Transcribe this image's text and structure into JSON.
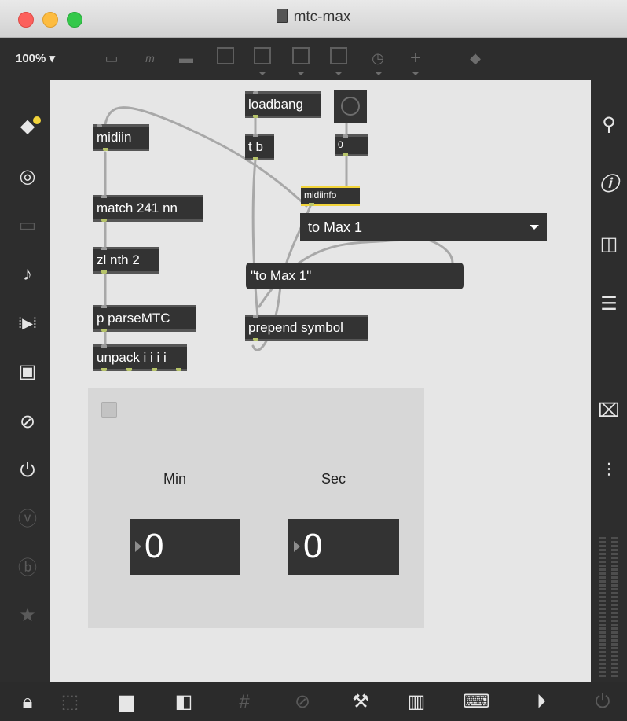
{
  "window": {
    "title": "mtc-max"
  },
  "toolbar": {
    "zoom": "100% ▾"
  },
  "objects": {
    "midiin": "midiin",
    "match": "match 241 nn",
    "zlnth": "zl nth 2",
    "parse": "p parseMTC",
    "unpack": "unpack i i i i",
    "loadbang": "loadbang",
    "tb": "t b",
    "zero": "0",
    "midiinfo": "midiinfo",
    "prepend": "prepend symbol"
  },
  "menu": {
    "selected": "to Max 1"
  },
  "message": {
    "text": "\"to Max 1\""
  },
  "panel": {
    "min_label": "Min",
    "sec_label": "Sec",
    "min_value": "0",
    "sec_value": "0"
  },
  "colors": {
    "canvas": "#e6e6e6",
    "object_bg": "#333333",
    "midiinfo_highlight": "#f2d43a",
    "panel_bg": "#d7d7d7"
  },
  "icons": {
    "left_sidebar": [
      "new-object-icon",
      "target-icon",
      "window-icon",
      "music-note-icon",
      "playback-icon",
      "image-icon",
      "paperclip-icon",
      "plug-icon",
      "v-circle-icon",
      "b-circle-icon",
      "star-icon"
    ],
    "right_sidebar": [
      "search-icon",
      "info-icon",
      "columns-icon",
      "list-icon",
      "camera-icon",
      "mixer-icon"
    ],
    "bottom_bar": [
      "lock-icon",
      "select-icon",
      "presentation-icon",
      "stack-icon",
      "grid-icon",
      "paperclip-plus-icon",
      "wrench-icon",
      "piano-icon",
      "keyboard-icon",
      "play-icon",
      "power-icon"
    ]
  }
}
